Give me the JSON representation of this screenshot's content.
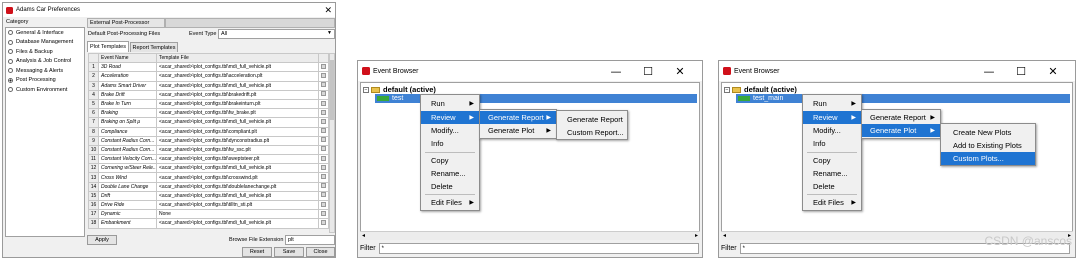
{
  "colors": {
    "highlight": "#1f74d2",
    "app_icon": "#d0101a",
    "tree_selection": "#3f82d4"
  },
  "prefs": {
    "title": "Adams Car Preferences",
    "category_label": "Category",
    "categories": [
      {
        "label": "General & Interface",
        "selected": false
      },
      {
        "label": "Database Management",
        "selected": false
      },
      {
        "label": "Files & Backup",
        "selected": false
      },
      {
        "label": "Analysis & Job Control",
        "selected": false
      },
      {
        "label": "Messaging & Alerts",
        "selected": false
      },
      {
        "label": "Post Processing",
        "selected": true
      },
      {
        "label": "Custom Environment",
        "selected": false
      }
    ],
    "section_title": "External Post-Processor",
    "default_files_label": "Default Post-Processing Files",
    "event_type_label": "Event Type",
    "event_type_value": "All",
    "tabs": [
      "Plot Templates",
      "Report Templates"
    ],
    "columns": [
      "",
      "Event Name",
      "Template File"
    ],
    "rows": [
      [
        "1",
        "3D Road",
        "<acar_shared>\\plot_configs.tbl\\mdi_full_vehicle.plt"
      ],
      [
        "2",
        "Acceleration",
        "<acar_shared>\\plot_configs.tbl\\acceleration.plt"
      ],
      [
        "3",
        "Adams Smart Driver",
        "<acar_shared>\\plot_configs.tbl\\mdi_full_vehicle.plt"
      ],
      [
        "4",
        "Brake Drift",
        "<acar_shared>\\plot_configs.tbl\\brakedrift.plt"
      ],
      [
        "5",
        "Brake In Turn",
        "<acar_shared>\\plot_configs.tbl\\brakeinturn.plt"
      ],
      [
        "6",
        "Braking",
        "<acar_shared>\\plot_configs.tbl\\fw_brake.plt"
      ],
      [
        "7",
        "Braking on Split μ",
        "<acar_shared>\\plot_configs.tbl\\mdi_full_vehicle.plt"
      ],
      [
        "8",
        "Compliance",
        "<acar_shared>\\plot_configs.tbl\\compliant.plt"
      ],
      [
        "9",
        "Constant Radius Corn...",
        "<acar_shared>\\plot_configs.tbl\\dynconstradius.plt"
      ],
      [
        "10",
        "Constant Radius Corn...",
        "<acar_shared>\\plot_configs.tbl\\fw_ssc.plt"
      ],
      [
        "11",
        "Constant Velocity Corn...",
        "<acar_shared>\\plot_configs.tbl\\sweptsteer.plt"
      ],
      [
        "12",
        "Cornering w/Steer Rele...",
        "<acar_shared>\\plot_configs.tbl\\mdi_full_vehicle.plt"
      ],
      [
        "13",
        "Cross Wind",
        "<acar_shared>\\plot_configs.tbl\\crosswind.plt"
      ],
      [
        "14",
        "Double Lane Change",
        "<acar_shared>\\plot_configs.tbl\\doublelanechange.plt"
      ],
      [
        "15",
        "Drift",
        "<acar_shared>\\plot_configs.tbl\\mdi_full_vehicle.plt"
      ],
      [
        "16",
        "Drive Ride",
        "<acar_shared>\\plot_configs.tbl\\tilltn_sti.plt"
      ],
      [
        "17",
        "Dynamic",
        "None"
      ],
      [
        "18",
        "Embankment",
        "<acar_shared>\\plot_configs.tbl\\mdi_full_vehicle.plt"
      ]
    ],
    "apply_label": "Apply",
    "browse_ext_label": "Browse File Extension",
    "browse_ext_value": "plt",
    "reset_label": "Reset",
    "save_label": "Save",
    "close_label": "Close"
  },
  "browser1": {
    "title": "Event Browser",
    "root_label": "default (active)",
    "child_label": "test",
    "context_menu": [
      "Run",
      "Review",
      "Modify...",
      "Info",
      "Copy",
      "Rename...",
      "Delete",
      "Edit Files"
    ],
    "submenu": [
      "Generate Report",
      "Generate Plot"
    ],
    "report_submenu": [
      "Generate Report",
      "Custom Report..."
    ],
    "filter_label": "Filter",
    "filter_value": "*"
  },
  "browser2": {
    "title": "Event Browser",
    "root_label": "default (active)",
    "child_label": "test_main",
    "context_menu": [
      "Run",
      "Review",
      "Modify...",
      "Info",
      "Copy",
      "Rename...",
      "Delete",
      "Edit Files"
    ],
    "submenu": [
      "Generate Report",
      "Generate Plot"
    ],
    "plot_submenu": [
      "Create New Plots",
      "Add to Existing Plots",
      "Custom Plots..."
    ],
    "filter_label": "Filter",
    "filter_value": "*"
  },
  "watermark": "CSDN @anscos"
}
